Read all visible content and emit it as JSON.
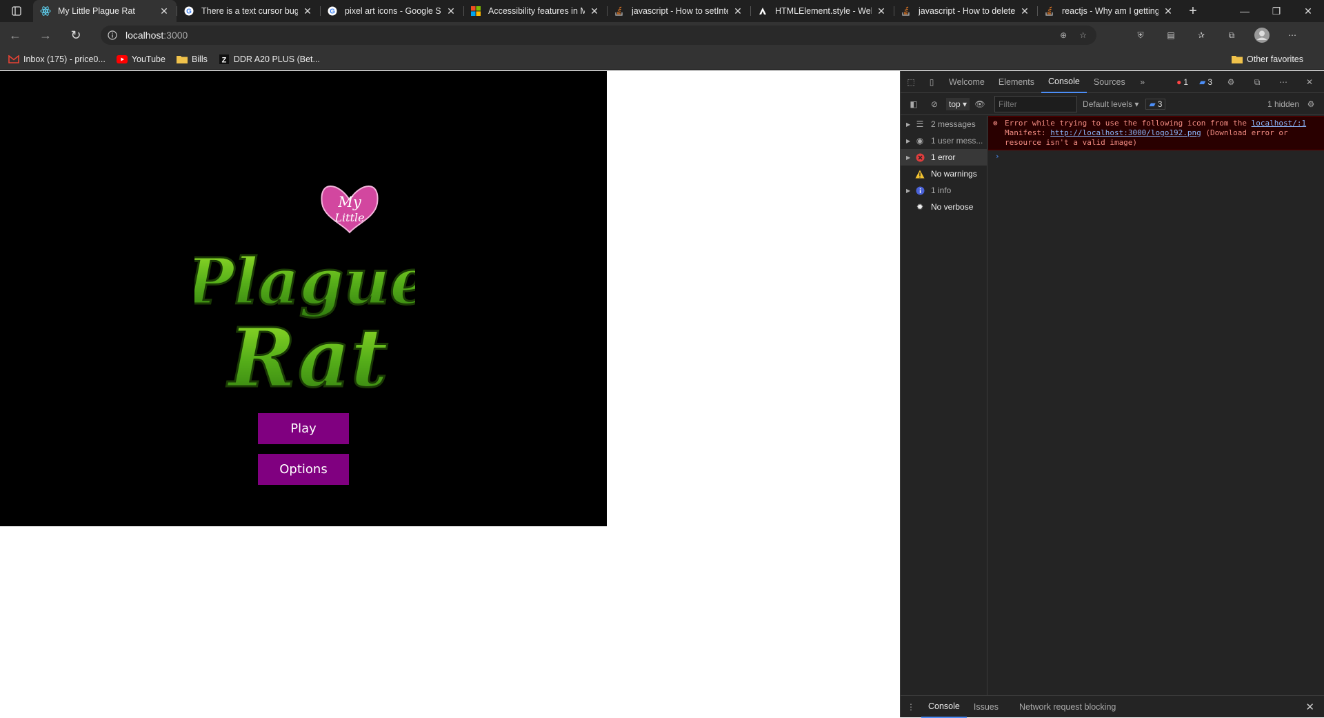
{
  "browser": {
    "tabs": [
      {
        "title": "My Little Plague Rat",
        "icon": "react-icon",
        "active": true
      },
      {
        "title": "There is a text cursor bug i",
        "icon": "google-icon"
      },
      {
        "title": "pixel art icons - Google Se",
        "icon": "google-icon"
      },
      {
        "title": "Accessibility features in Mi",
        "icon": "microsoft-icon"
      },
      {
        "title": "javascript - How to setInte",
        "icon": "stackoverflow-icon"
      },
      {
        "title": "HTMLElement.style - Web",
        "icon": "mdn-icon"
      },
      {
        "title": "javascript - How to delete",
        "icon": "stackoverflow-icon"
      },
      {
        "title": "reactjs - Why am I getting",
        "icon": "stackoverflow-icon"
      }
    ],
    "url_host": "localhost",
    "url_port": ":3000",
    "bookmarks": [
      {
        "label": "Inbox (175) - price0...",
        "icon": "gmail-icon"
      },
      {
        "label": "YouTube",
        "icon": "youtube-icon"
      },
      {
        "label": "Bills",
        "icon": "folder-icon"
      },
      {
        "label": "DDR A20 PLUS (Bet...",
        "icon": "z-icon"
      }
    ],
    "other_favorites": "Other favorites"
  },
  "game": {
    "logo_top": "My",
    "logo_mid": "Little",
    "logo_word1": "Plague",
    "logo_word2": "Rat",
    "play_label": "Play",
    "options_label": "Options",
    "button_color": "#800080"
  },
  "devtools": {
    "tabs": [
      "Welcome",
      "Elements",
      "Console",
      "Sources"
    ],
    "active_tab": "Console",
    "error_count": "1",
    "message_count": "3",
    "context": "top",
    "filter_placeholder": "Filter",
    "levels": "Default levels",
    "issues_count": "3",
    "hidden": "1 hidden",
    "sidebar": [
      {
        "label": "2 messages",
        "icon": "list-icon"
      },
      {
        "label": "1 user mess...",
        "icon": "user-icon"
      },
      {
        "label": "1 error",
        "icon": "error-icon"
      },
      {
        "label": "No warnings",
        "icon": "warning-icon"
      },
      {
        "label": "1 info",
        "icon": "info-icon"
      },
      {
        "label": "No verbose",
        "icon": "bug-icon"
      }
    ],
    "error": {
      "text1": "Error while trying to use the following icon from the ",
      "source": "localhost/:1",
      "text2": "Manifest: ",
      "url": "http://localhost:3000/logo192.png",
      "text3": " (Download error or resource isn't a valid image)"
    },
    "drawer_tabs": [
      "Console",
      "Issues",
      "Network request blocking"
    ]
  }
}
